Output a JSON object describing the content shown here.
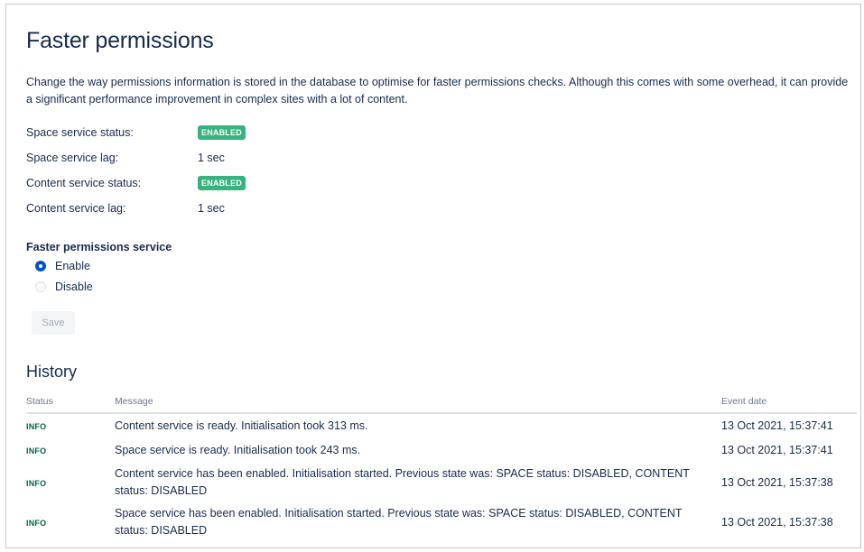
{
  "page": {
    "title": "Faster permissions",
    "description": "Change the way permissions information is stored in the database to optimise for faster permissions checks. Although this comes with some overhead, it can provide a significant performance improvement in complex sites with a lot of content."
  },
  "status": {
    "space_status_label": "Space service status:",
    "space_status_value": "ENABLED",
    "space_lag_label": "Space service lag:",
    "space_lag_value": "1 sec",
    "content_status_label": "Content service status:",
    "content_status_value": "ENABLED",
    "content_lag_label": "Content service lag:",
    "content_lag_value": "1 sec"
  },
  "service": {
    "heading": "Faster permissions service",
    "options": [
      {
        "label": "Enable",
        "selected": true
      },
      {
        "label": "Disable",
        "selected": false
      }
    ],
    "save_label": "Save"
  },
  "history": {
    "heading": "History",
    "columns": [
      "Status",
      "Message",
      "Event date"
    ],
    "rows": [
      {
        "status": "INFO",
        "message": "Content service is ready. Initialisation took 313 ms.",
        "date": "13 Oct 2021, 15:37:41"
      },
      {
        "status": "INFO",
        "message": "Space service is ready. Initialisation took 243 ms.",
        "date": "13 Oct 2021, 15:37:41"
      },
      {
        "status": "INFO",
        "message": "Content service has been enabled. Initialisation started. Previous state was: SPACE status: DISABLED, CONTENT status: DISABLED",
        "date": "13 Oct 2021, 15:37:38"
      },
      {
        "status": "INFO",
        "message": "Space service has been enabled. Initialisation started. Previous state was: SPACE status: DISABLED, CONTENT status: DISABLED",
        "date": "13 Oct 2021, 15:37:38"
      }
    ]
  },
  "colors": {
    "enabled_lozenge": "#36b37e",
    "info_text": "#006644",
    "radio_selected": "#0052cc"
  }
}
